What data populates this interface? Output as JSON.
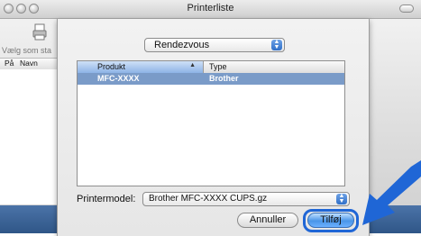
{
  "window": {
    "title": "Printerliste"
  },
  "background": {
    "toolbar_label": "Vælg som sta",
    "columns": [
      "På",
      "Navn"
    ]
  },
  "sheet": {
    "discovery_popup": "Rendezvous",
    "list": {
      "headers": [
        "Produkt",
        "Type"
      ],
      "rows": [
        {
          "product": "MFC-XXXX",
          "type": "Brother"
        }
      ]
    },
    "printer_model_label": "Printermodel:",
    "printer_model_value": "Brother MFC-XXXX CUPS.gz",
    "cancel_label": "Annuller",
    "add_label": "Tilføj"
  },
  "colors": {
    "accent": "#1f66d6",
    "selection": "#7a9bc8"
  }
}
